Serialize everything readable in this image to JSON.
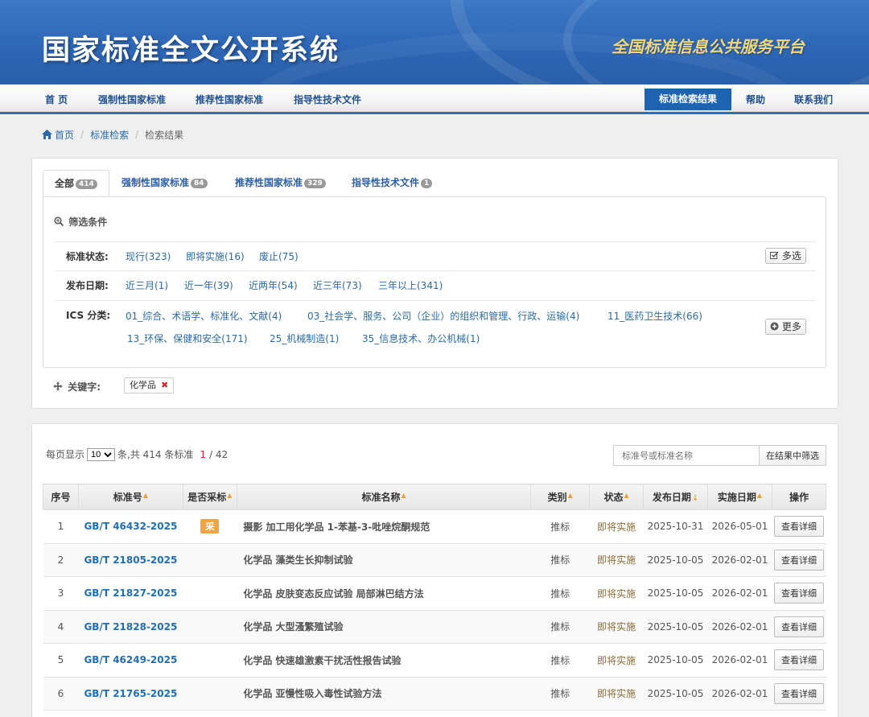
{
  "header": {
    "title": "国家标准全文公开系统",
    "platform": "全国标准信息公共服务平台"
  },
  "nav": {
    "items": [
      "首 页",
      "强制性国家标准",
      "推荐性国家标准",
      "指导性技术文件"
    ],
    "active": "标准检索结果",
    "help": "帮助",
    "contact": "联系我们"
  },
  "breadcrumb": [
    "首页",
    "标准检索",
    "检索结果"
  ],
  "tabs": [
    {
      "label": "全部",
      "count": "414"
    },
    {
      "label": "强制性国家标准",
      "count": "84"
    },
    {
      "label": "推荐性国家标准",
      "count": "329"
    },
    {
      "label": "指导性技术文件",
      "count": "1"
    }
  ],
  "filters": {
    "title": "筛选条件",
    "status_label": "标准状态:",
    "status_options": [
      "现行(323)",
      "即将实施(16)",
      "废止(75)"
    ],
    "multi_label": "多选",
    "date_label": "发布日期:",
    "date_options": [
      "近三月(1)",
      "近一年(39)",
      "近两年(54)",
      "近三年(73)",
      "三年以上(341)"
    ],
    "ics_label": "ICS 分类:",
    "ics_options": [
      "01_综合、术语学、标准化、文献(4)",
      "03_社会学、服务、公司（企业）的组织和管理、行政、运输(4)",
      "11_医药卫生技术(66)",
      "13_环保、保健和安全(171)",
      "25_机械制造(1)",
      "35_信息技术、办公机械(1)"
    ],
    "more_label": "更多",
    "keyword_label": "关键字:",
    "keyword": "化学品"
  },
  "pager": {
    "per_page_label": "每页显示",
    "per_page": "10",
    "total_text": "条,共 414 条标准",
    "current_page": "1",
    "total_pages": "/ 42"
  },
  "search": {
    "placeholder": "标准号或标准名称",
    "button": "在结果中筛选"
  },
  "table": {
    "headers": [
      "序号",
      "标准号",
      "是否采标",
      "标准名称",
      "类别",
      "状态",
      "发布日期",
      "实施日期",
      "操作"
    ],
    "rows": [
      {
        "no": "1",
        "code": "GB/T 46432-2025",
        "adopted": "采",
        "name": "摄影 加工用化学品 1-苯基-3-吡唑烷酮规范",
        "type": "推标",
        "status": "即将实施",
        "pub": "2025-10-31",
        "impl": "2026-05-01",
        "action": "查看详细"
      },
      {
        "no": "2",
        "code": "GB/T 21805-2025",
        "adopted": "",
        "name": "化学品 藻类生长抑制试验",
        "type": "推标",
        "status": "即将实施",
        "pub": "2025-10-05",
        "impl": "2026-02-01",
        "action": "查看详细"
      },
      {
        "no": "3",
        "code": "GB/T 21827-2025",
        "adopted": "",
        "name": "化学品 皮肤变态反应试验 局部淋巴结方法",
        "type": "推标",
        "status": "即将实施",
        "pub": "2025-10-05",
        "impl": "2026-02-01",
        "action": "查看详细"
      },
      {
        "no": "4",
        "code": "GB/T 21828-2025",
        "adopted": "",
        "name": "化学品 大型溞繁殖试验",
        "type": "推标",
        "status": "即将实施",
        "pub": "2025-10-05",
        "impl": "2026-02-01",
        "action": "查看详细"
      },
      {
        "no": "5",
        "code": "GB/T 46249-2025",
        "adopted": "",
        "name": "化学品 快速雄激素干扰活性报告试验",
        "type": "推标",
        "status": "即将实施",
        "pub": "2025-10-05",
        "impl": "2026-02-01",
        "action": "查看详细"
      },
      {
        "no": "6",
        "code": "GB/T 21765-2025",
        "adopted": "",
        "name": "化学品 亚慢性吸入毒性试验方法",
        "type": "推标",
        "status": "即将实施",
        "pub": "2025-10-05",
        "impl": "2026-02-01",
        "action": "查看详细"
      }
    ]
  },
  "colors": {
    "brand_blue": "#2e67b6",
    "link_blue": "#2b6aa8",
    "accent_orange": "#f0a445",
    "page_red": "#d9232d"
  }
}
